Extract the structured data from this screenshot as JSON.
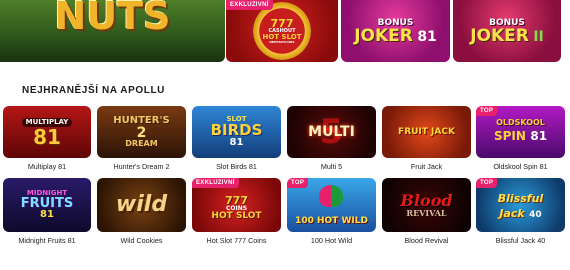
{
  "featured": [
    {
      "art": "NUTS"
    },
    {
      "badge": "EXKLUZIVNÍ",
      "art_top": "777",
      "art_mid": "CASHOUT",
      "art_bottom": "HOT SLOT",
      "art_sub": "DEPOSITCOINS"
    },
    {
      "art_top": "BONUS",
      "art_main": "JOKER",
      "art_num": "81"
    },
    {
      "art_top": "BONUS",
      "art_main": "JOKER",
      "art_num": "II"
    }
  ],
  "section_title": "NEJHRANĚJŠÍ NA APOLLU",
  "games_row1": [
    {
      "name": "Multiplay 81",
      "art": "MULTIPLAY",
      "art_num": "81"
    },
    {
      "name": "Hunter's Dream 2",
      "art": "HUNTER'S",
      "art_num": "2",
      "art_sub": "DREAM"
    },
    {
      "name": "Slot Birds 81",
      "art": "SLOT",
      "art_main": "BIRDS",
      "art_num": "81"
    },
    {
      "name": "Multi 5",
      "art": "MULTI",
      "art_num": "5"
    },
    {
      "name": "Fruit Jack",
      "art": "FRUIT JACK"
    },
    {
      "name": "Oldskool Spin 81",
      "badge": "TOP",
      "art": "OLDSKOOL",
      "art_main": "SPIN",
      "art_num": "81"
    }
  ],
  "games_row2": [
    {
      "name": "Midnight Fruits 81",
      "art": "MIDNIGHT",
      "art_main": "FRUITS",
      "art_num": "81"
    },
    {
      "name": "Wild Cookies",
      "art": "wild"
    },
    {
      "name": "Hot Slot 777 Coins",
      "badge": "EXKLUZIVNÍ",
      "art_top": "777",
      "art_mid": "COINS",
      "art_bottom": "HOT SLOT"
    },
    {
      "name": "100 Hot Wild",
      "badge": "TOP",
      "art": "100 HOT WILD"
    },
    {
      "name": "Blood Revival",
      "art": "Blood",
      "art_sub": "REVIVAL"
    },
    {
      "name": "Blissful Jack 40",
      "badge": "TOP",
      "art": "Blissful",
      "art_main": "Jack",
      "art_num": "40"
    }
  ],
  "colors": {
    "badge": "#e8216d",
    "title": "#1b1b1b"
  }
}
